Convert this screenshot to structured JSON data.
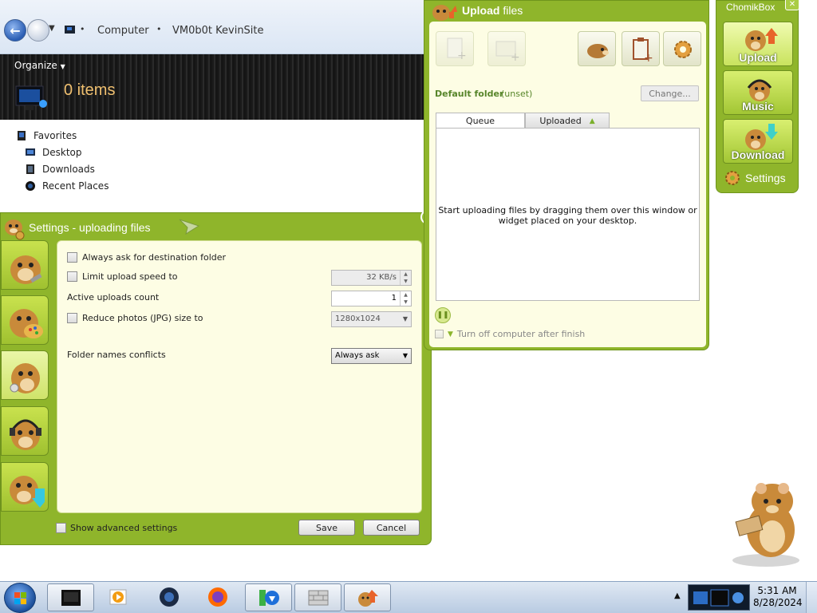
{
  "explorer": {
    "breadcrumb": [
      "Computer",
      "VM0b0t KevinSite"
    ],
    "organize_label": "Organize",
    "items_count": "0 items",
    "nav": [
      "Favorites",
      "Desktop",
      "Downloads",
      "Recent Places"
    ]
  },
  "settings": {
    "title": "Settings - uploading files",
    "close_glyph": "x",
    "always_ask_label": "Always ask for destination folder",
    "limit_speed_label": "Limit upload speed to",
    "limit_speed_value": "32 KB/s",
    "active_uploads_label": "Active uploads count",
    "active_uploads_value": "1",
    "reduce_photos_label": "Reduce photos (JPG) size to",
    "reduce_photos_value": "1280x1024",
    "folder_conflicts_label": "Folder names conflicts",
    "folder_conflicts_value": "Always ask",
    "show_advanced_label": "Show advanced settings",
    "save_label": "Save",
    "cancel_label": "Cancel"
  },
  "upload": {
    "title_bold": "Upload",
    "title_rest": " files",
    "default_folder_label": "Default folder",
    "default_folder_value": "(unset)",
    "change_label": "Change...",
    "tab_queue": "Queue",
    "tab_uploaded": "Uploaded",
    "queue_message_line1": "Start uploading files by dragging them over this window or",
    "queue_message_line2": "widget placed on your desktop.",
    "turn_off_label": "Turn off computer after finish"
  },
  "widget": {
    "title": "ChomikBox",
    "upload_label": "Upload",
    "music_label": "Music",
    "download_label": "Download",
    "settings_label": "Settings"
  },
  "taskbar": {
    "time": "5:31 AM",
    "date": "8/28/2024"
  },
  "colors": {
    "chomik_green": "#8fb52b",
    "panel_cream": "#fdfde4",
    "folder_text_green": "#57852a"
  }
}
